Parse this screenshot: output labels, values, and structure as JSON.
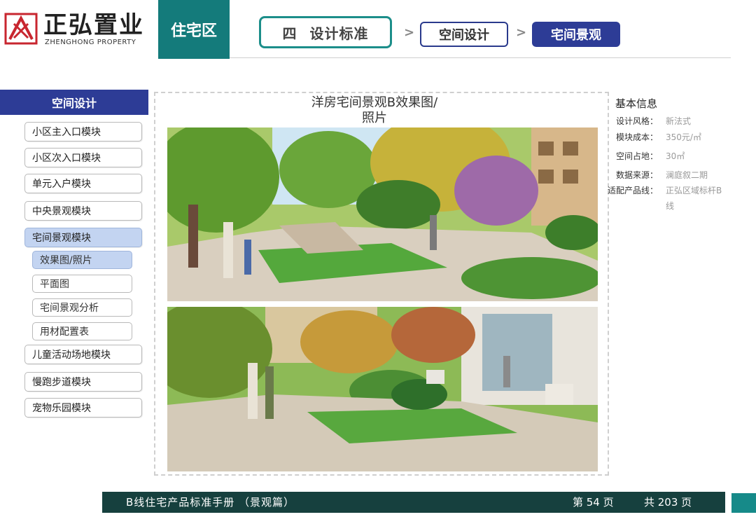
{
  "brand": {
    "name_cn": "正弘置业",
    "name_en": "ZHENGHONG PROPERTY",
    "colors": {
      "logo_red": "#c8262f",
      "teal": "#147b7b",
      "navy": "#2d3c96",
      "footer": "#16403e"
    }
  },
  "header": {
    "zone": "住宅区",
    "breadcrumb": [
      {
        "label": "四  设计标准"
      },
      {
        "label": "空间设计"
      },
      {
        "label": "宅间景观"
      }
    ],
    "separator": ">"
  },
  "sidebar": {
    "title": "空间设计",
    "items": [
      {
        "label": "小区主入口模块"
      },
      {
        "label": "小区次入口模块"
      },
      {
        "label": "单元入户模块"
      },
      {
        "label": "中央景观模块"
      },
      {
        "label": "宅间景观模块",
        "active": true
      },
      {
        "label": "儿童活动场地模块"
      },
      {
        "label": "慢跑步道模块"
      },
      {
        "label": "宠物乐园模块"
      }
    ],
    "subitems": [
      {
        "label": "效果图/照片",
        "active": true
      },
      {
        "label": "平面图"
      },
      {
        "label": "宅间景观分析"
      },
      {
        "label": "用材配置表"
      }
    ]
  },
  "main": {
    "title_line1": "洋房宅间景观B效果图/",
    "title_line2": "照片",
    "images": [
      "landscape-render-top",
      "landscape-render-bottom"
    ]
  },
  "info": {
    "title": "基本信息",
    "rows": [
      {
        "label": "设计风格：",
        "value": "新法式"
      },
      {
        "label": "模块成本：",
        "value": "350元/㎡"
      },
      {
        "label": "空间占地：",
        "value": "30㎡"
      },
      {
        "label": "数据来源：",
        "value": "澜庭叙二期"
      },
      {
        "label": "适配产品线：",
        "value_line1": "正弘区域标杆B",
        "value_line2": "线"
      }
    ]
  },
  "footer": {
    "title": "B线住宅产品标准手册 （景观篇）",
    "page": "第 54 页",
    "total": "共 203 页"
  }
}
